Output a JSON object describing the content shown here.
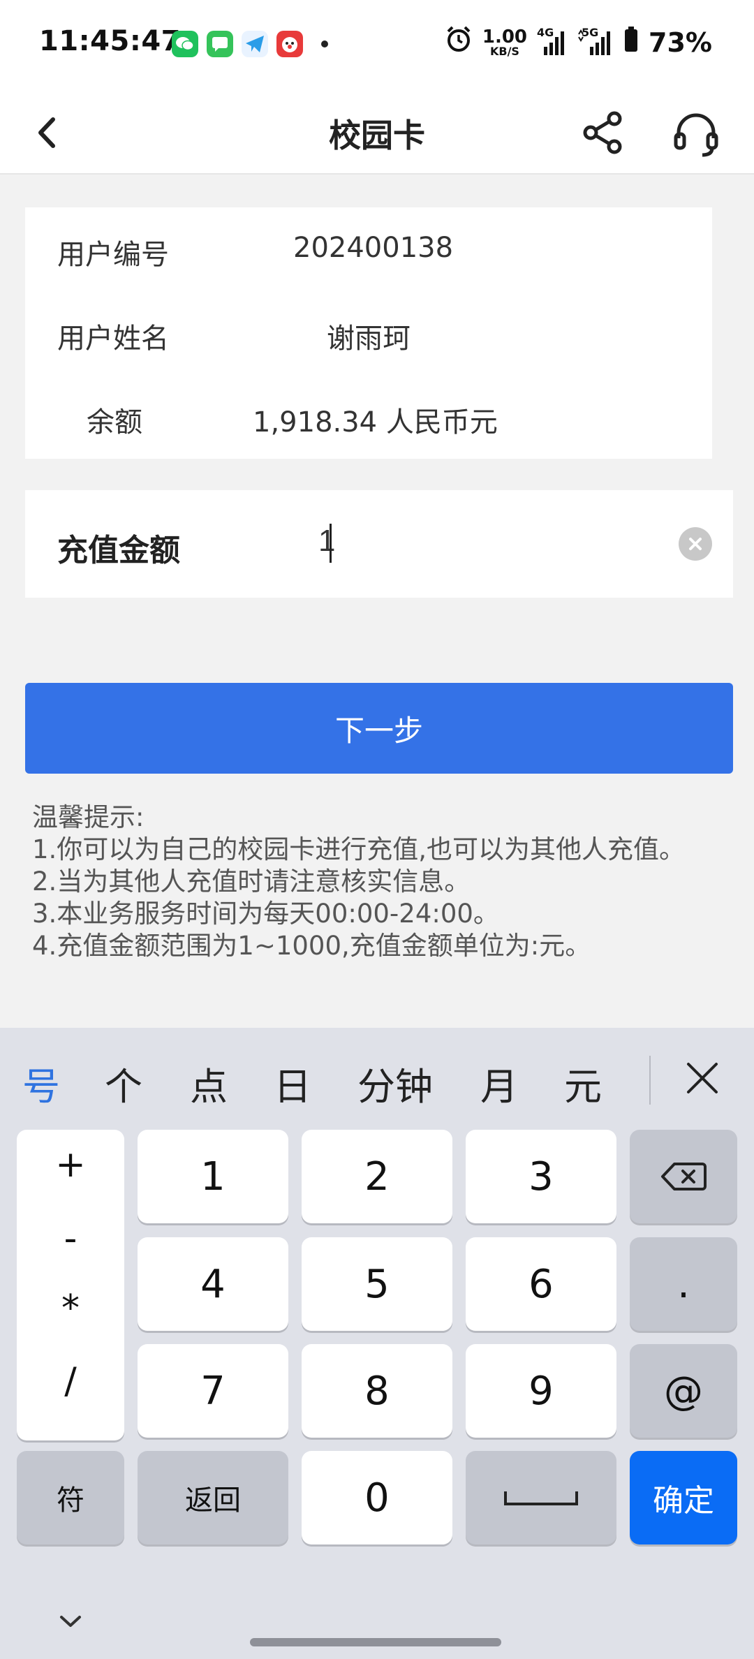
{
  "status_bar": {
    "time": "11:45:47",
    "net_speed_value": "1.00",
    "net_speed_unit": "KB/S",
    "network_1": "4G",
    "network_2": "5G",
    "battery": "73%"
  },
  "header": {
    "title": "校园卡"
  },
  "info": {
    "user_id_label": "用户编号",
    "user_id_value": "202400138",
    "user_name_label": "用户姓名",
    "user_name_value": "谢雨珂",
    "balance_label": "余额",
    "balance_value": "1,918.34 人民币元"
  },
  "recharge": {
    "amount_label": "充值金额",
    "amount_value": "1"
  },
  "next_button": "下一步",
  "tips": {
    "title": "温馨提示:",
    "line1": "1.你可以为自己的校园卡进行充值,也可以为其他人充值。",
    "line2": "2.当为其他人充值时请注意核实信息。",
    "line3": "3.本业务服务时间为每天00:00-24:00。",
    "line4": "4.充值金额范围为1~1000,充值金额单位为:元。"
  },
  "keyboard": {
    "suggestions": [
      "号",
      "个",
      "点",
      "日",
      "分钟",
      "月",
      "元"
    ],
    "symbols": [
      "+",
      "-",
      "*",
      "/"
    ],
    "digits": [
      "1",
      "2",
      "3",
      "4",
      "5",
      "6",
      "7",
      "8",
      "9",
      "0"
    ],
    "dot": ".",
    "at": "@",
    "symbol_key": "符",
    "back_key": "返回",
    "confirm_key": "确定"
  },
  "colors": {
    "primary_button": "#3472e7",
    "confirm_key": "#0a6cf5",
    "active_suggestion": "#2f73e0"
  }
}
